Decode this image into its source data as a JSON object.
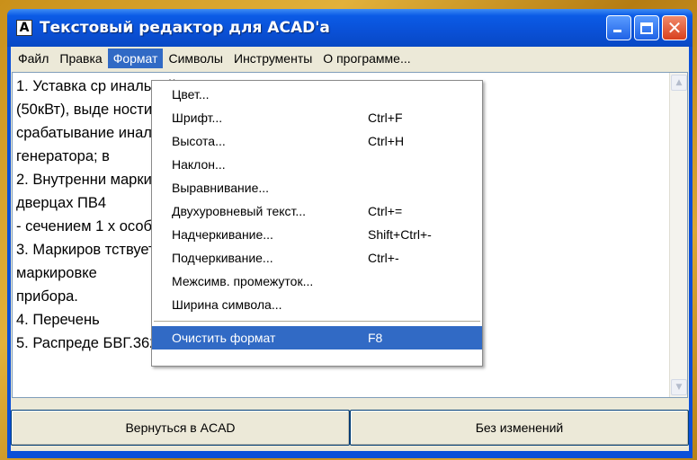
{
  "window": {
    "title": "Текстовый редактор для ACAD'а",
    "icon_letter": "A"
  },
  "menubar": {
    "items": [
      {
        "label": "Файл"
      },
      {
        "label": "Правка"
      },
      {
        "label": "Формат",
        "active": true
      },
      {
        "label": "Символы"
      },
      {
        "label": "Инструменты"
      },
      {
        "label": "О программе..."
      }
    ]
  },
  "editor": {
    "lines": [
      "1. Уставка ср                                                        инальной мощности",
      "(50кВт), выде                                                        ности отстроить на",
      "срабатывание                                                       инального тока",
      "генератора; в",
      "  2. Внутренни                                                      марки ПВЗ, на",
      "дверцах ПВ4",
      "- сечением 1                                                          х особо.",
      "  3. Маркиров                                                       тствует штатной",
      "маркировке",
      "прибора.",
      "  4. Перечень",
      "  5. Распреде                                                      БВГ.36261.001ЭЭ."
    ]
  },
  "format_menu": {
    "items": [
      {
        "label": "Цвет...",
        "shortcut": ""
      },
      {
        "label": "Шрифт...",
        "shortcut": "Ctrl+F"
      },
      {
        "label": "Высота...",
        "shortcut": "Ctrl+H"
      },
      {
        "label": "Наклон...",
        "shortcut": ""
      },
      {
        "label": "Выравнивание...",
        "shortcut": ""
      },
      {
        "label": "Двухуровневый текст...",
        "shortcut": "Ctrl+="
      },
      {
        "label": "Надчеркивание...",
        "shortcut": "Shift+Ctrl+-"
      },
      {
        "label": "Подчеркивание...",
        "shortcut": "Ctrl+-"
      },
      {
        "label": "Межсимв. промежуток...",
        "shortcut": ""
      },
      {
        "label": "Ширина символа...",
        "shortcut": ""
      }
    ],
    "clear_item": {
      "label": "Очистить формат",
      "shortcut": "F8"
    }
  },
  "buttons": {
    "return_label": "Вернуться в ACAD",
    "nochange_label": "Без изменений"
  },
  "colors": {
    "titlebar": "#0a50d6",
    "highlight": "#316ac5",
    "face": "#ece9d8"
  },
  "icons": {
    "app": "app-icon",
    "minimize": "minimize-icon",
    "maximize": "maximize-icon",
    "close": "close-icon",
    "scroll_up": "chevron-up-icon",
    "scroll_down": "chevron-down-icon"
  }
}
